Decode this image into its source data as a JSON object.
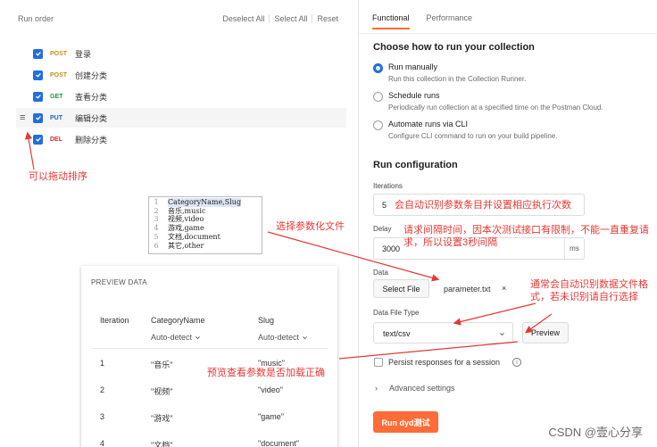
{
  "left": {
    "title": "Run order",
    "actions": [
      "Deselect All",
      "Select All",
      "Reset"
    ],
    "requests": [
      {
        "method": "POST",
        "name": "登录"
      },
      {
        "method": "POST",
        "name": "创建分类"
      },
      {
        "method": "GET",
        "name": "查看分类"
      },
      {
        "method": "PUT",
        "name": "编辑分类"
      },
      {
        "method": "DEL",
        "name": "删除分类"
      }
    ]
  },
  "csv": {
    "line_numbers": [
      "1",
      "2",
      "3",
      "4",
      "5",
      "6"
    ],
    "lines": [
      "CategoryName,Slug",
      "音乐,music",
      "视频,video",
      "游戏,game",
      "文档,document",
      "其它,other"
    ]
  },
  "preview": {
    "title": "PREVIEW DATA",
    "headers": [
      "Iteration",
      "CategoryName",
      "Slug"
    ],
    "detect": [
      "Auto-detect",
      "Auto-detect"
    ],
    "rows": [
      [
        "1",
        "\"音乐\"",
        "\"music\""
      ],
      [
        "2",
        "\"视频\"",
        "\"video\""
      ],
      [
        "3",
        "\"游戏\"",
        "\"game\""
      ],
      [
        "4",
        "\"文档\"",
        "\"document\""
      ]
    ]
  },
  "right": {
    "tabs": [
      "Functional",
      "Performance"
    ],
    "choose_title": "Choose how to run your collection",
    "options": [
      {
        "label": "Run manually",
        "desc": "Run this collection in the Collection Runner."
      },
      {
        "label": "Schedule runs",
        "desc": "Periodically run collection at a specified time on the Postman Cloud."
      },
      {
        "label": "Automate runs via CLI",
        "desc": "Configure CLI command to run on your build pipeline."
      }
    ],
    "config_title": "Run configuration",
    "iterations_label": "Iterations",
    "iterations_value": "5",
    "delay_label": "Delay",
    "delay_value": "3000",
    "delay_unit": "ms",
    "data_label": "Data",
    "select_file": "Select File",
    "file_name": "parameter.txt",
    "file_close": "×",
    "data_type_label": "Data File Type",
    "data_type_value": "text/csv",
    "preview_button": "Preview",
    "persist_label": "Persist responses for a session",
    "advanced_label": "Advanced settings",
    "run_button": "Run dyd测试"
  },
  "annotations": {
    "drag": "可以拖动排序",
    "choose_param": "选择参数化文件",
    "iterations_note": "会自动识别参数条目并设置相应执行次数",
    "delay_note": "请求间隔时间，因本次测试接口有限制，不能一直重复请求，所以设置3秒间隔",
    "file_type_note": "通常会自动识别数据文件格式，若未识别请自行选择",
    "preview_note": "预览查看参数是否加载正确"
  },
  "watermark": "CSDN @壹心分享",
  "colors": {
    "accent": "#ff6c37",
    "checkbox": "#1f6fe0",
    "annotation": "#e53935"
  }
}
